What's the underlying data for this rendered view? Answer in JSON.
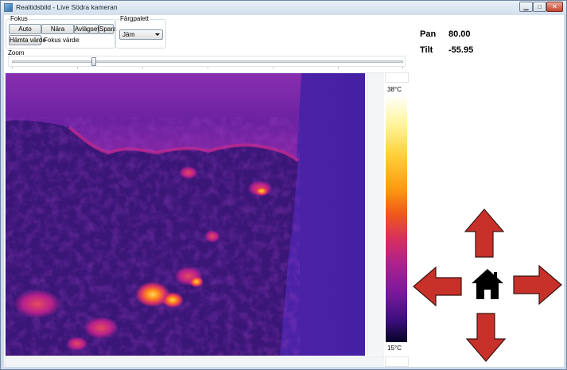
{
  "window": {
    "title": "Realtidsbild - Live Södra kameran",
    "minimize_glyph": "▁",
    "maximize_glyph": "□",
    "close_glyph": "✕"
  },
  "focus": {
    "group_label": "Fokus",
    "auto_label": "Auto",
    "near_label": "Nära",
    "far_label": "Avlägset",
    "save_label": "Spara",
    "fetch_label": "Hämta värde",
    "value_label": "Fokus värde",
    "value": ":"
  },
  "palette": {
    "group_label": "Färgpalett",
    "selected": "Järn"
  },
  "zoom": {
    "label": "Zoom",
    "level_fraction": 0.21
  },
  "temperature_scale": {
    "max_label": "38°C",
    "min_label": "15°C"
  },
  "ptz": {
    "pan_label": "Pan",
    "pan_value": "80.00",
    "tilt_label": "Tilt",
    "tilt_value": "-55.95"
  },
  "colors": {
    "arrow_fill": "#c8302a",
    "arrow_stroke": "#3a1512",
    "home_fill": "#000000"
  },
  "icons": {
    "up": "arrow-up-icon",
    "down": "arrow-down-icon",
    "left": "arrow-left-icon",
    "right": "arrow-right-icon",
    "home": "home-icon"
  }
}
